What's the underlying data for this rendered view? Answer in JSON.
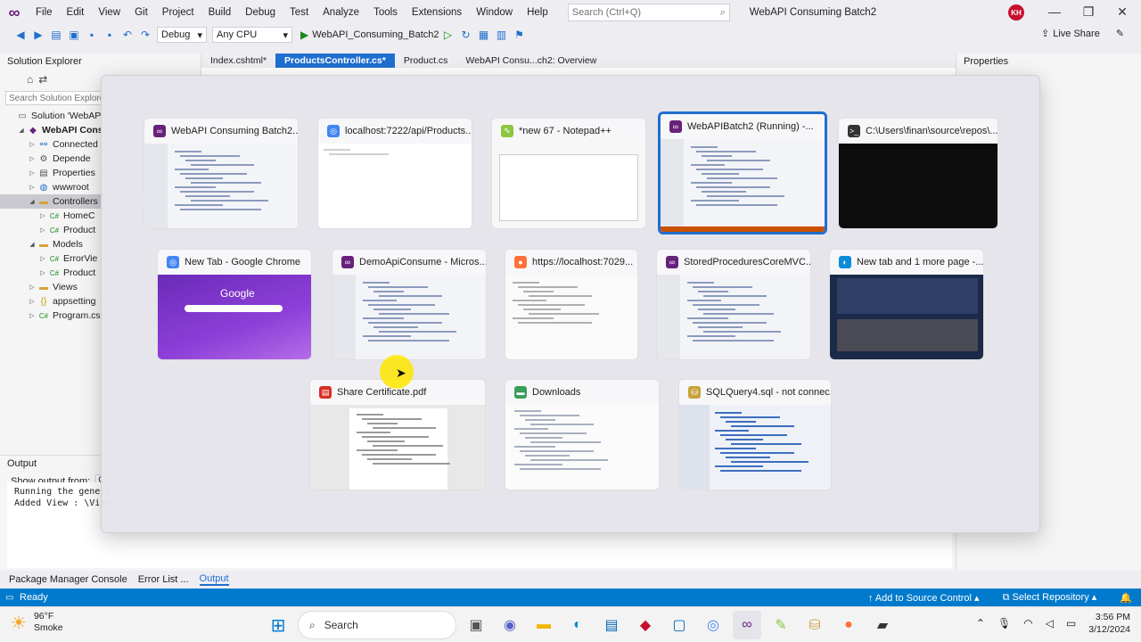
{
  "titlebar": {
    "menu": [
      "File",
      "Edit",
      "View",
      "Git",
      "Project",
      "Build",
      "Debug",
      "Test",
      "Analyze",
      "Tools",
      "Extensions",
      "Window",
      "Help"
    ],
    "search_placeholder": "Search (Ctrl+Q)",
    "window_title": "WebAPI Consuming Batch2",
    "avatar_initials": "KH"
  },
  "toolbar": {
    "config": "Debug",
    "platform": "Any CPU",
    "run_target": "WebAPI_Consuming_Batch2",
    "live_share": "Live Share"
  },
  "solution_explorer": {
    "title": "Solution Explorer",
    "search_placeholder": "Search Solution Explore",
    "items": [
      {
        "label": "Solution 'WebAPI",
        "indent": 0,
        "icon": "solution-icon",
        "arrow": ""
      },
      {
        "label": "WebAPI Cons",
        "indent": 1,
        "icon": "project-icon",
        "arrow": "◢",
        "bold": true
      },
      {
        "label": "Connected",
        "indent": 2,
        "icon": "connected-icon",
        "arrow": "▷"
      },
      {
        "label": "Depende",
        "indent": 2,
        "icon": "dependencies-icon",
        "arrow": "▷"
      },
      {
        "label": "Properties",
        "indent": 2,
        "icon": "properties-icon",
        "arrow": "▷"
      },
      {
        "label": "wwwroot",
        "indent": 2,
        "icon": "globe-icon",
        "arrow": "▷"
      },
      {
        "label": "Controllers",
        "indent": 2,
        "icon": "folder-icon",
        "arrow": "◢",
        "selected": true
      },
      {
        "label": "HomeC",
        "indent": 3,
        "icon": "csharp-icon",
        "arrow": "▷"
      },
      {
        "label": "Product",
        "indent": 3,
        "icon": "csharp-icon",
        "arrow": "▷"
      },
      {
        "label": "Models",
        "indent": 2,
        "icon": "folder-icon",
        "arrow": "◢"
      },
      {
        "label": "ErrorVie",
        "indent": 3,
        "icon": "csharp-icon",
        "arrow": "▷"
      },
      {
        "label": "Product",
        "indent": 3,
        "icon": "csharp-icon",
        "arrow": "▷"
      },
      {
        "label": "Views",
        "indent": 2,
        "icon": "folder-icon",
        "arrow": "▷"
      },
      {
        "label": "appsetting",
        "indent": 2,
        "icon": "json-icon",
        "arrow": "▷"
      },
      {
        "label": "Program.cs",
        "indent": 2,
        "icon": "csharp-icon",
        "arrow": "▷"
      }
    ]
  },
  "editor_tabs": [
    {
      "label": "Index.cshtml*",
      "active": false
    },
    {
      "label": "ProductsController.cs*",
      "active": true
    },
    {
      "label": "Product.cs",
      "active": false
    },
    {
      "label": "WebAPI Consu...ch2: Overview",
      "active": false
    }
  ],
  "properties": {
    "title": "Properties"
  },
  "output": {
    "title": "Output",
    "show_from_label": "Show output from:",
    "show_from_value": "Co",
    "lines": [
      "Running the genera",
      "Added View : \\View"
    ]
  },
  "bottom_tabs": [
    {
      "label": "Package Manager Console",
      "active": false
    },
    {
      "label": "Error List ...",
      "active": false
    },
    {
      "label": "Output",
      "active": true
    }
  ],
  "statusbar": {
    "ready": "Ready",
    "add_source": "Add to Source Control",
    "select_repo": "Select Repository"
  },
  "switcher": {
    "windows": [
      {
        "title": "WebAPI Consuming Batch2...",
        "icon": "visual-studio-icon",
        "color": "#68217a",
        "thumb": "code"
      },
      {
        "title": "localhost:7222/api/Products...",
        "icon": "chrome-icon",
        "color": "#4285f4",
        "thumb": "blank"
      },
      {
        "title": "*new 67 - Notepad++",
        "icon": "notepadpp-icon",
        "color": "#8dc63f",
        "thumb": "notepad"
      },
      {
        "title": "WebAPIBatch2 (Running) -...",
        "icon": "visual-studio-icon",
        "color": "#68217a",
        "thumb": "code",
        "selected": true
      },
      {
        "title": "C:\\Users\\finan\\source\\repos\\...",
        "icon": "console-icon",
        "color": "#333333",
        "thumb": "console"
      },
      {
        "title": "New Tab - Google Chrome",
        "icon": "chrome-icon",
        "color": "#4285f4",
        "thumb": "google"
      },
      {
        "title": "DemoApiConsume - Micros...",
        "icon": "visual-studio-icon",
        "color": "#68217a",
        "thumb": "code"
      },
      {
        "title": "https://localhost:7029...",
        "icon": "firefox-icon",
        "color": "#ff7139",
        "thumb": "web"
      },
      {
        "title": "StoredProceduresCoreMVC...",
        "icon": "visual-studio-icon",
        "color": "#68217a",
        "thumb": "code"
      },
      {
        "title": "New tab and 1 more page -...",
        "icon": "edge-icon",
        "color": "#0c8bd8",
        "thumb": "shop"
      },
      {
        "title": "Share Certificate.pdf",
        "icon": "pdf-icon",
        "color": "#d93025",
        "thumb": "pdf"
      },
      {
        "title": "Downloads",
        "icon": "explorer-icon",
        "color": "#3a9e5b",
        "thumb": "explorer"
      },
      {
        "title": "SQLQuery4.sql - not connec...",
        "icon": "ssms-icon",
        "color": "#c8a23a",
        "thumb": "sql"
      }
    ],
    "google_logo": "Google"
  },
  "taskbar": {
    "weather_temp": "96°F",
    "weather_desc": "Smoke",
    "search_label": "Search",
    "time": "3:56 PM",
    "date": "3/12/2024"
  }
}
